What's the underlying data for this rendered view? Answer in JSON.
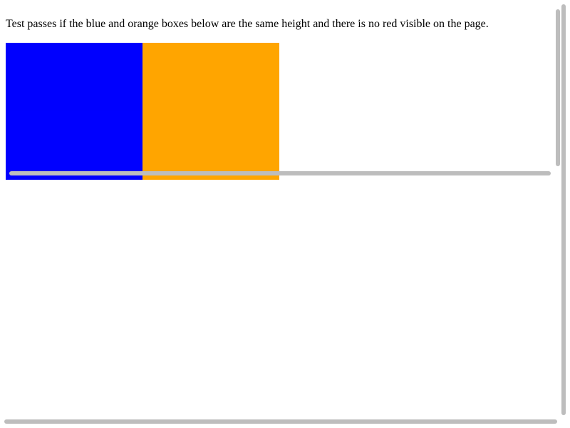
{
  "instructions": {
    "text": "Test passes if the blue and orange boxes below are the same height and there is no red visible on the page."
  },
  "boxes": {
    "blue_color": "#0000ff",
    "blue_top_color": "#0000fe",
    "orange_color": "#ffa500"
  },
  "scrollbars": {
    "color": "#bdbdbd"
  }
}
